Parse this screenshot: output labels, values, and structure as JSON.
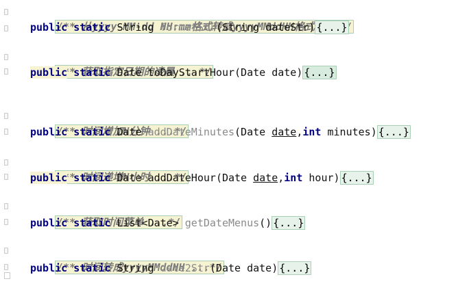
{
  "methods": [
    {
      "comment": "/** 从yyyy-MM-dd HH:mm格式转成yyyyMMddHH格式 ...*/",
      "kw1": "public",
      "kw2": "static",
      "ret": "String",
      "name": "formatStr",
      "sig": "(String dateStr)",
      "body": "{...}"
    },
    {
      "comment": "/** 获取指定日期的凌晨 ...*/",
      "kw1": "public",
      "kw2": "static",
      "ret": "Date",
      "name": "toDayStartHour",
      "sig": "(Date date)",
      "body": "{...}"
    },
    {
      "comment": "/** 时间增加N分钟 ...*/",
      "kw1": "public",
      "kw2": "static",
      "ret": "Date",
      "name": "addDateMinutes",
      "sig_open": "(Date ",
      "param": "date",
      "sig_mid": ",",
      "kw3": "int",
      "sig_close": " minutes)",
      "body": "{...}"
    },
    {
      "comment": "/** 时间递增N小时 ...*/",
      "kw1": "public",
      "kw2": "static",
      "ret": "Date",
      "name": "addDateHour",
      "sig_open": "(Date ",
      "param": "date",
      "sig_mid": ",",
      "kw3": "int",
      "sig_close": " hour)",
      "body": "{...}"
    },
    {
      "comment": "/** 获取时间菜单 ...*/",
      "kw1": "public",
      "kw2": "static",
      "ret": "List<Date>",
      "name": "getDateMenus",
      "sig": "()",
      "body": "{...}"
    },
    {
      "comment": "/** 时间转成yyyyMMddHH ...*/",
      "kw1": "public",
      "kw2": "static",
      "ret": "String",
      "name": "date2Str",
      "sig": "(Date date)",
      "body": "{...}"
    }
  ]
}
